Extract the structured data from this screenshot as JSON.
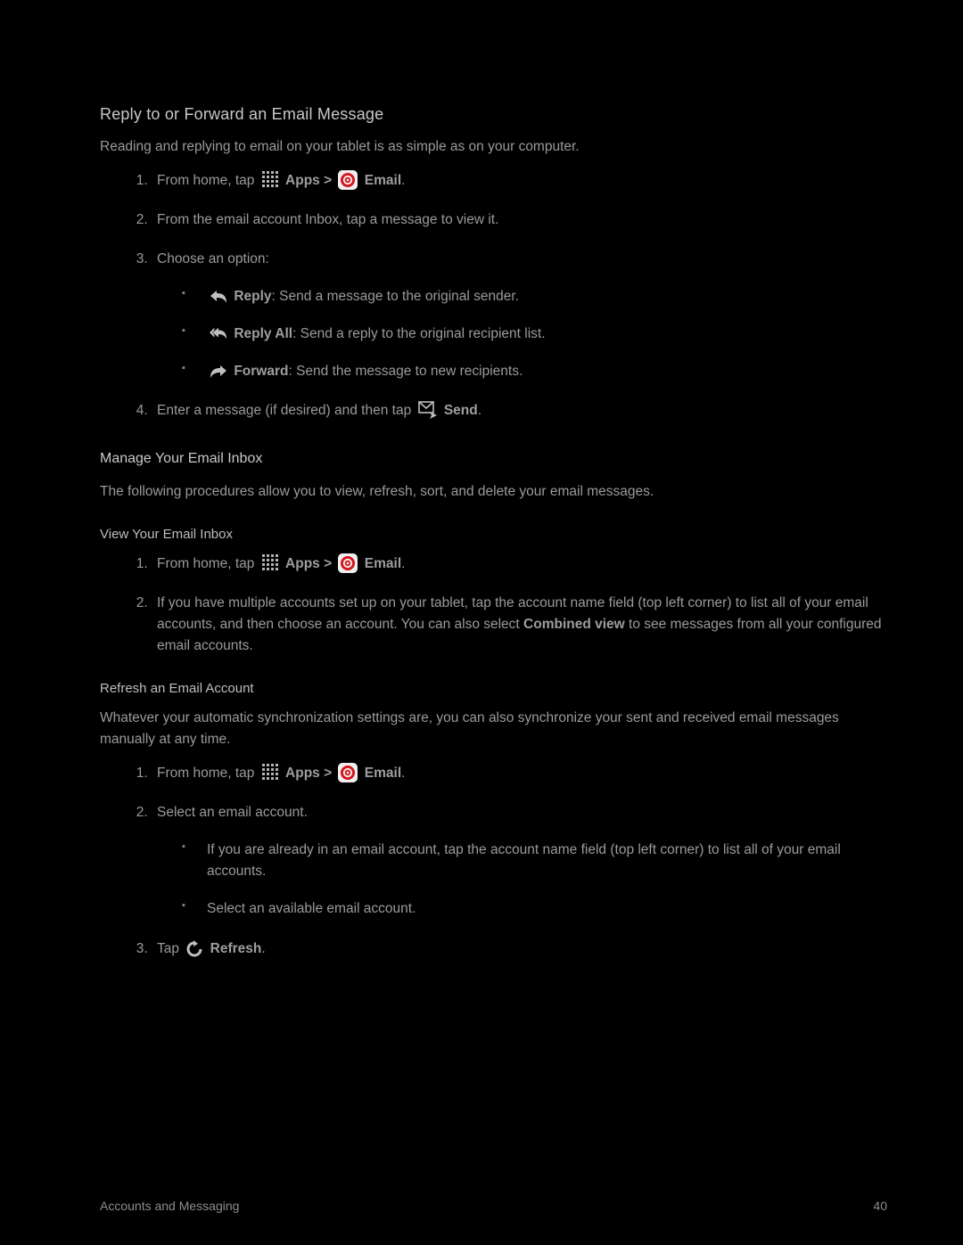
{
  "section1": {
    "heading": "Reply to or Forward an Email Message",
    "intro": "Reading and replying to email on your tablet is as simple as on your computer.",
    "step1_prefix": "From home, tap",
    "apps_label": " Apps >",
    "email_label": " Email",
    "step2": "From the email account Inbox, tap a message to view it.",
    "step3": "Choose an option:",
    "opt1_b": "Reply",
    "opt1_t": ": Send a message to the original sender.",
    "opt2_b": "Reply All",
    "opt2_t": ": Send a reply to the original recipient list.",
    "opt3_b": "Forward",
    "opt3_t": ": Send the message to new recipients.",
    "step4_a": "Enter a message (if desired) and then tap",
    "step4_b": " Send",
    "period": "."
  },
  "section2": {
    "heading": "Manage Your Email Inbox",
    "intro": "The following procedures allow you to view, refresh, sort, and delete your email messages.",
    "sub_heading": "View Your Email Inbox",
    "step1_prefix": "From home, tap",
    "apps_label": " Apps >",
    "email_label": " Email",
    "step2_a": "If you have multiple accounts set up on your tablet, tap the account name field (top left corner) to list all of your email accounts, and then choose an account. You can also select ",
    "step2_b": "Combined view",
    "step2_c": " to see messages from all your configured email accounts."
  },
  "section3": {
    "sub_heading": "Refresh an Email Account",
    "intro": "Whatever your automatic synchronization settings are, you can also synchronize your sent and received email messages manually at any time.",
    "step1_prefix": "From home, tap",
    "apps_label": " Apps >",
    "email_label": " Email",
    "step2": "Select an email account.",
    "sub1": "If you are already in an email account, tap the account name field (top left corner) to list all of your email accounts.",
    "sub2": "Select an available email account.",
    "step3_a": "Tap",
    "step3_b": " Refresh",
    "period": "."
  },
  "footer": {
    "left": "Accounts and Messaging",
    "right": "40"
  }
}
